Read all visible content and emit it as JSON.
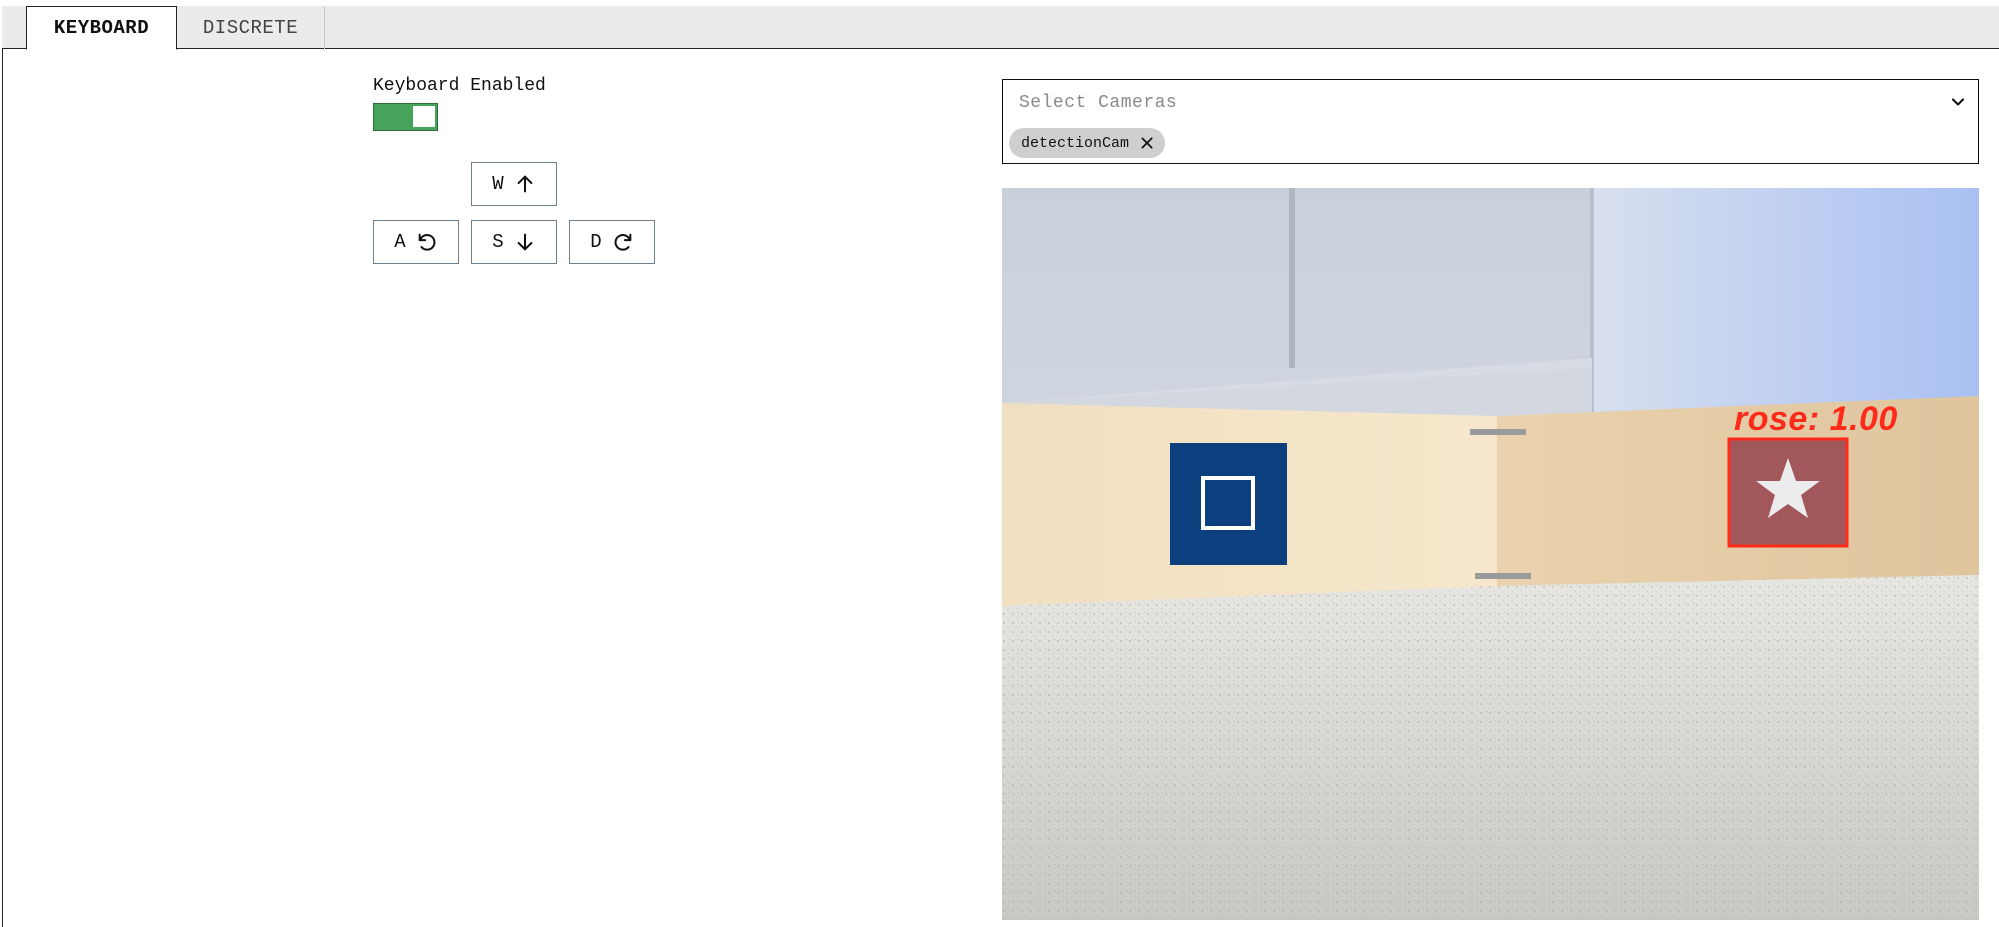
{
  "tabs": [
    {
      "label": "KEYBOARD",
      "active": true
    },
    {
      "label": "DISCRETE",
      "active": false
    }
  ],
  "keyboard": {
    "enabled_label": "Keyboard Enabled",
    "enabled": true,
    "keys": {
      "w": {
        "label": "W",
        "icon": "arrow-up-icon"
      },
      "a": {
        "label": "A",
        "icon": "rotate-ccw-icon"
      },
      "s": {
        "label": "S",
        "icon": "arrow-down-icon"
      },
      "d": {
        "label": "D",
        "icon": "rotate-cw-icon"
      }
    }
  },
  "cameras": {
    "placeholder": "Select Cameras",
    "selected": [
      "detectionCam"
    ]
  },
  "video": {
    "detection_label": "rose: 1.00"
  },
  "colors": {
    "toggle_on": "#46a35a",
    "detection_box": "#ff2a1a",
    "chip_bg": "#cfcfcf"
  }
}
